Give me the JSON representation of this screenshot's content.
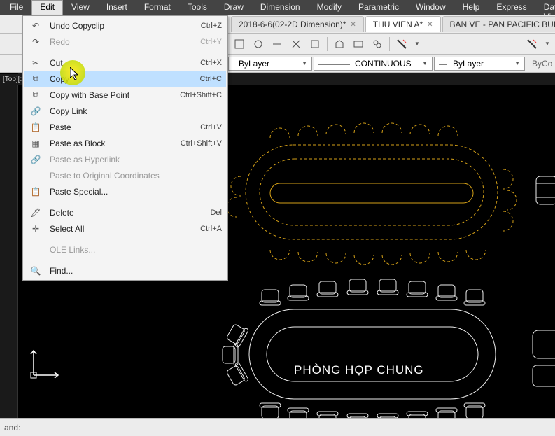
{
  "menubar": {
    "items": [
      "File",
      "Edit",
      "View",
      "Insert",
      "Format",
      "Tools",
      "Draw",
      "Dimension",
      "Modify",
      "Parametric",
      "Window",
      "Help",
      "Express",
      "Data View"
    ],
    "active_index": 1
  },
  "tabs": [
    {
      "label": "2018-6-6(02-2D Dimension)*",
      "active": false
    },
    {
      "label": "THU VIEN A*",
      "active": true
    },
    {
      "label": "BAN VE - PAN PACIFIC BUILDING -",
      "active": false
    }
  ],
  "props": {
    "color": {
      "label": "ByLayer",
      "swatch": "#ffffff"
    },
    "linetype": {
      "label": "CONTINUOUS",
      "preview": "————"
    },
    "lineweight": {
      "label": "ByLayer",
      "preview": "—"
    },
    "plotstyle": {
      "label": "ByCo"
    }
  },
  "edit_menu": [
    {
      "icon": "undo",
      "label": "Undo Copyclip",
      "shortcut": "Ctrl+Z"
    },
    {
      "icon": "redo",
      "label": "Redo",
      "shortcut": "Ctrl+Y",
      "disabled": true
    },
    {
      "divider": true
    },
    {
      "icon": "cut",
      "label": "Cut",
      "shortcut": "Ctrl+X"
    },
    {
      "icon": "copy",
      "label": "Copy",
      "shortcut": "Ctrl+C",
      "highlighted": true
    },
    {
      "icon": "copy-base",
      "label": "Copy with Base Point",
      "shortcut": "Ctrl+Shift+C"
    },
    {
      "icon": "copy-link",
      "label": "Copy Link",
      "shortcut": ""
    },
    {
      "icon": "paste",
      "label": "Paste",
      "shortcut": "Ctrl+V"
    },
    {
      "icon": "paste-block",
      "label": "Paste as Block",
      "shortcut": "Ctrl+Shift+V"
    },
    {
      "icon": "paste-link",
      "label": "Paste as Hyperlink",
      "shortcut": "",
      "disabled": true
    },
    {
      "icon": "",
      "label": "Paste to Original Coordinates",
      "shortcut": "",
      "disabled": true
    },
    {
      "icon": "paste-special",
      "label": "Paste Special...",
      "shortcut": ""
    },
    {
      "divider": true
    },
    {
      "icon": "delete",
      "label": "Delete",
      "shortcut": "Del"
    },
    {
      "icon": "select-all",
      "label": "Select All",
      "shortcut": "Ctrl+A"
    },
    {
      "divider": true
    },
    {
      "icon": "",
      "label": "OLE Links...",
      "shortcut": "",
      "disabled": true
    },
    {
      "divider": true
    },
    {
      "icon": "find",
      "label": "Find...",
      "shortcut": ""
    }
  ],
  "ruler": {
    "left_label": "[Top][:"
  },
  "drawing": {
    "room_label": "PHÒNG HỌP CHUNG"
  },
  "statusbar": {
    "text": "and:"
  }
}
